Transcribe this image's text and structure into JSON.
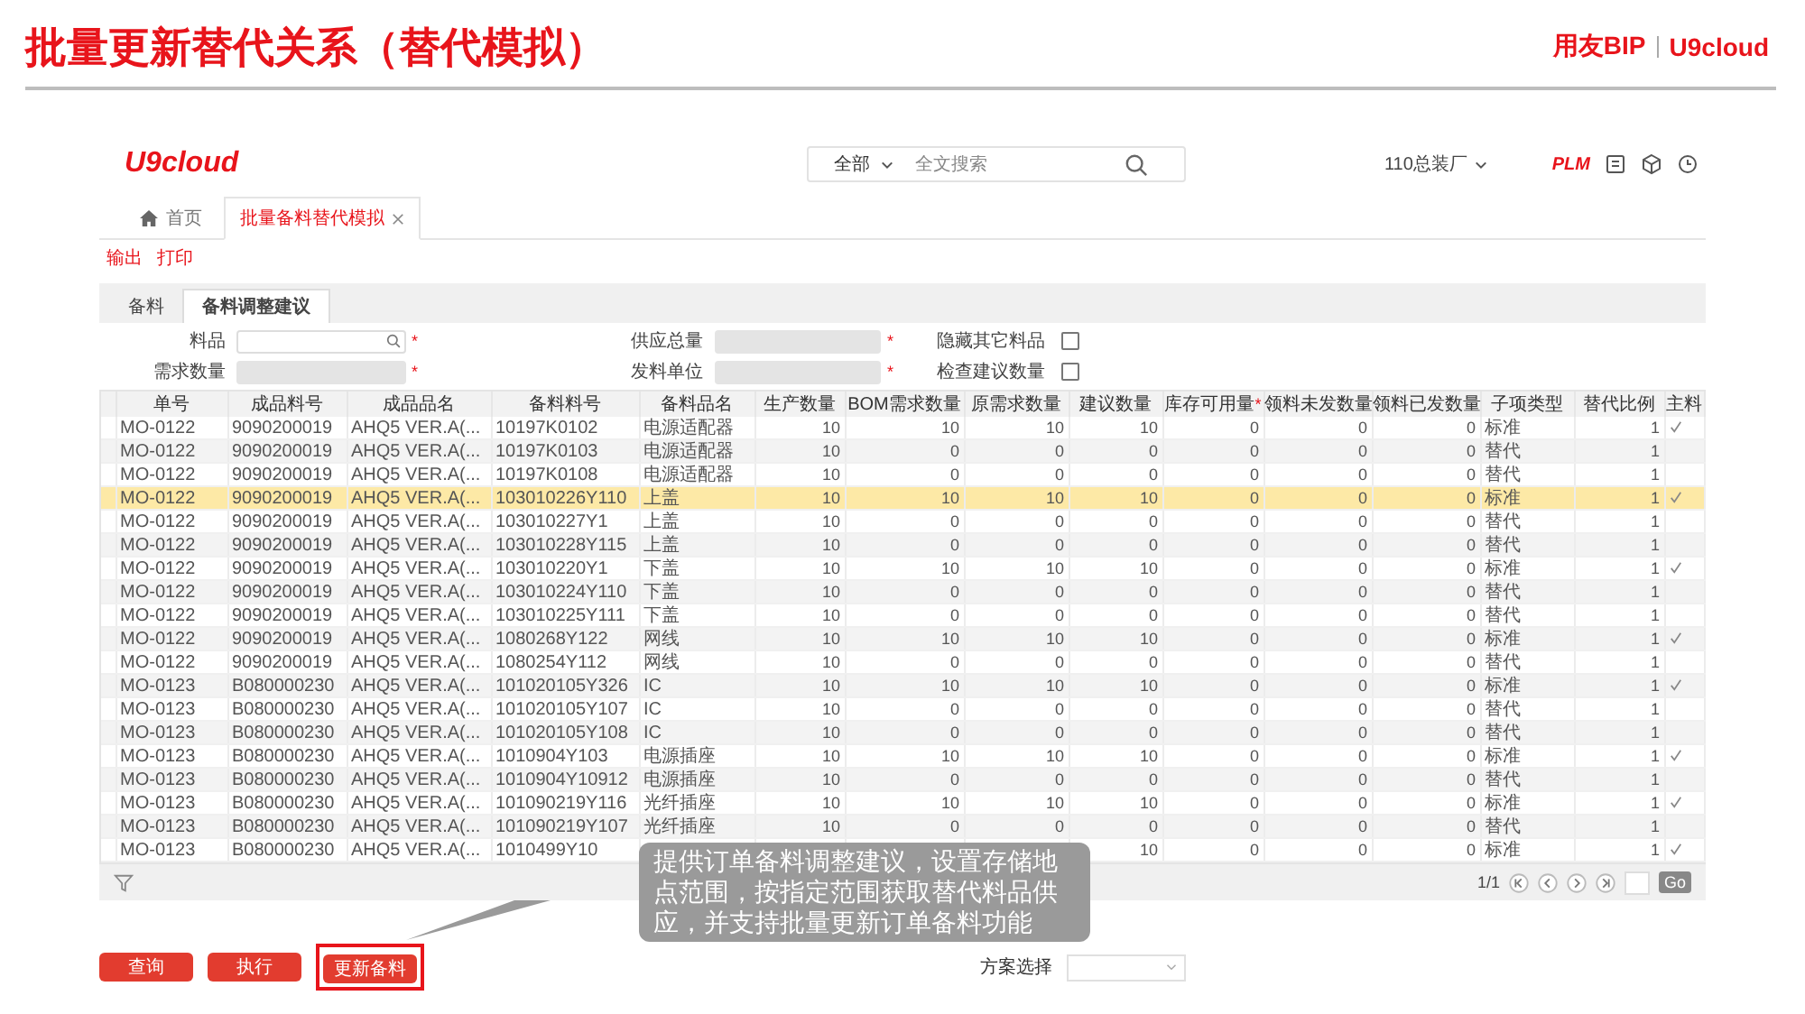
{
  "slide": {
    "title": "批量更新替代关系（替代模拟）",
    "brand_left": "用友BIP",
    "brand_right": "U9cloud"
  },
  "app": {
    "logo": "U9cloud",
    "search": {
      "scope": "全部",
      "placeholder": "全文搜索"
    },
    "org": "110总装厂",
    "plm": "PLM"
  },
  "tabs": [
    {
      "label": "首页",
      "kind": "home",
      "selected": false
    },
    {
      "label": "批量备料替代模拟",
      "kind": "page",
      "selected": true
    }
  ],
  "toolbar": [
    "输出",
    "打印"
  ],
  "subtabs": [
    {
      "label": "备料",
      "selected": false
    },
    {
      "label": "备料调整建议",
      "selected": true
    }
  ],
  "form": [
    {
      "label": "料品",
      "kind": "lookup",
      "mark": "*"
    },
    {
      "label": "供应总量",
      "kind": "readonly",
      "mark": "*"
    },
    {
      "label": "隐藏其它料品",
      "kind": "checkbox",
      "checked": false
    },
    {
      "label": "需求数量",
      "kind": "readonly",
      "mark": "*"
    },
    {
      "label": "发料单位",
      "kind": "readonly",
      "mark": "*"
    },
    {
      "label": "检查建议数量",
      "kind": "checkbox",
      "checked": false
    }
  ],
  "table": {
    "columns": [
      {
        "label": "单号",
        "kind": "text"
      },
      {
        "label": "成品料号",
        "kind": "text"
      },
      {
        "label": "成品品名",
        "kind": "text"
      },
      {
        "label": "备料料号",
        "kind": "text"
      },
      {
        "label": "备料品名",
        "kind": "text"
      },
      {
        "label": "生产数量",
        "kind": "num"
      },
      {
        "label": "BOM需求数量",
        "kind": "num"
      },
      {
        "label": "原需求数量",
        "kind": "num"
      },
      {
        "label": "建议数量",
        "kind": "num"
      },
      {
        "label": "库存可用量",
        "kind": "num",
        "mark": "*"
      },
      {
        "label": "领料未发数量",
        "kind": "num"
      },
      {
        "label": "领料已发数量",
        "kind": "num"
      },
      {
        "label": "子项类型",
        "kind": "text"
      },
      {
        "label": "替代比例",
        "kind": "num"
      },
      {
        "label": "主料",
        "kind": "check"
      }
    ],
    "rows": [
      {
        "selected": false,
        "main": true,
        "cells": [
          "MO-0122",
          "9090200019",
          "AHQ5 VER.A(...",
          "10197K0102",
          "电源适配器",
          "10",
          "10",
          "10",
          "10",
          "0",
          "0",
          "0",
          "标准",
          "1"
        ]
      },
      {
        "selected": false,
        "main": false,
        "cells": [
          "MO-0122",
          "9090200019",
          "AHQ5 VER.A(...",
          "10197K0103",
          "电源适配器",
          "10",
          "0",
          "0",
          "0",
          "0",
          "0",
          "0",
          "替代",
          "1"
        ]
      },
      {
        "selected": false,
        "main": false,
        "cells": [
          "MO-0122",
          "9090200019",
          "AHQ5 VER.A(...",
          "10197K0108",
          "电源适配器",
          "10",
          "0",
          "0",
          "0",
          "0",
          "0",
          "0",
          "替代",
          "1"
        ]
      },
      {
        "selected": true,
        "main": true,
        "cells": [
          "MO-0122",
          "9090200019",
          "AHQ5 VER.A(...",
          "103010226Y110",
          "上盖",
          "10",
          "10",
          "10",
          "10",
          "0",
          "0",
          "0",
          "标准",
          "1"
        ]
      },
      {
        "selected": false,
        "main": false,
        "cells": [
          "MO-0122",
          "9090200019",
          "AHQ5 VER.A(...",
          "103010227Y1",
          "上盖",
          "10",
          "0",
          "0",
          "0",
          "0",
          "0",
          "0",
          "替代",
          "1"
        ]
      },
      {
        "selected": false,
        "main": false,
        "cells": [
          "MO-0122",
          "9090200019",
          "AHQ5 VER.A(...",
          "103010228Y115",
          "上盖",
          "10",
          "0",
          "0",
          "0",
          "0",
          "0",
          "0",
          "替代",
          "1"
        ]
      },
      {
        "selected": false,
        "main": true,
        "cells": [
          "MO-0122",
          "9090200019",
          "AHQ5 VER.A(...",
          "103010220Y1",
          "下盖",
          "10",
          "10",
          "10",
          "10",
          "0",
          "0",
          "0",
          "标准",
          "1"
        ]
      },
      {
        "selected": false,
        "main": false,
        "cells": [
          "MO-0122",
          "9090200019",
          "AHQ5 VER.A(...",
          "103010224Y110",
          "下盖",
          "10",
          "0",
          "0",
          "0",
          "0",
          "0",
          "0",
          "替代",
          "1"
        ]
      },
      {
        "selected": false,
        "main": false,
        "cells": [
          "MO-0122",
          "9090200019",
          "AHQ5 VER.A(...",
          "103010225Y111",
          "下盖",
          "10",
          "0",
          "0",
          "0",
          "0",
          "0",
          "0",
          "替代",
          "1"
        ]
      },
      {
        "selected": false,
        "main": true,
        "cells": [
          "MO-0122",
          "9090200019",
          "AHQ5 VER.A(...",
          "1080268Y122",
          "网线",
          "10",
          "10",
          "10",
          "10",
          "0",
          "0",
          "0",
          "标准",
          "1"
        ]
      },
      {
        "selected": false,
        "main": false,
        "cells": [
          "MO-0122",
          "9090200019",
          "AHQ5 VER.A(...",
          "1080254Y112",
          "网线",
          "10",
          "0",
          "0",
          "0",
          "0",
          "0",
          "0",
          "替代",
          "1"
        ]
      },
      {
        "selected": false,
        "main": true,
        "cells": [
          "MO-0123",
          "B080000230",
          "AHQ5 VER.A(...",
          "101020105Y326",
          "IC",
          "10",
          "10",
          "10",
          "10",
          "0",
          "0",
          "0",
          "标准",
          "1"
        ]
      },
      {
        "selected": false,
        "main": false,
        "cells": [
          "MO-0123",
          "B080000230",
          "AHQ5 VER.A(...",
          "101020105Y107",
          "IC",
          "10",
          "0",
          "0",
          "0",
          "0",
          "0",
          "0",
          "替代",
          "1"
        ]
      },
      {
        "selected": false,
        "main": false,
        "cells": [
          "MO-0123",
          "B080000230",
          "AHQ5 VER.A(...",
          "101020105Y108",
          "IC",
          "10",
          "0",
          "0",
          "0",
          "0",
          "0",
          "0",
          "替代",
          "1"
        ]
      },
      {
        "selected": false,
        "main": true,
        "cells": [
          "MO-0123",
          "B080000230",
          "AHQ5 VER.A(...",
          "1010904Y103",
          "电源插座",
          "10",
          "10",
          "10",
          "10",
          "0",
          "0",
          "0",
          "标准",
          "1"
        ]
      },
      {
        "selected": false,
        "main": false,
        "cells": [
          "MO-0123",
          "B080000230",
          "AHQ5 VER.A(...",
          "1010904Y10912",
          "电源插座",
          "10",
          "0",
          "0",
          "0",
          "0",
          "0",
          "0",
          "替代",
          "1"
        ]
      },
      {
        "selected": false,
        "main": true,
        "cells": [
          "MO-0123",
          "B080000230",
          "AHQ5 VER.A(...",
          "101090219Y116",
          "光纤插座",
          "10",
          "10",
          "10",
          "10",
          "0",
          "0",
          "0",
          "标准",
          "1"
        ]
      },
      {
        "selected": false,
        "main": false,
        "cells": [
          "MO-0123",
          "B080000230",
          "AHQ5 VER.A(...",
          "101090219Y107",
          "光纤插座",
          "10",
          "0",
          "0",
          "0",
          "0",
          "0",
          "0",
          "替代",
          "1"
        ]
      },
      {
        "selected": false,
        "main": true,
        "cells": [
          "MO-0123",
          "B080000230",
          "AHQ5 VER.A(...",
          "1010499Y10",
          null,
          null,
          null,
          null,
          "10",
          "0",
          "0",
          "0",
          "标准",
          "1"
        ]
      }
    ]
  },
  "pager": {
    "page": "1/1",
    "go": "Go"
  },
  "actions": [
    {
      "label": "查询",
      "highlighted": false
    },
    {
      "label": "执行",
      "highlighted": false
    },
    {
      "label": "更新备料",
      "highlighted": true
    }
  ],
  "scheme": {
    "label": "方案选择"
  },
  "callout": "提供订单备料调整建议，设置存储地点范围，按指定范围获取替代料品供应，并支持批量更新订单备料功能"
}
